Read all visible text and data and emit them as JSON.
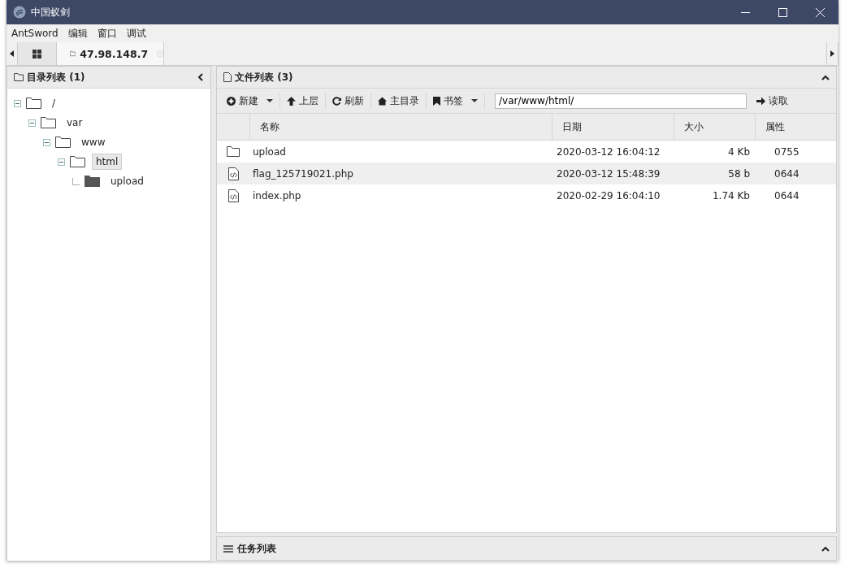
{
  "window": {
    "title": "中国蚁剑"
  },
  "menu": [
    "AntSword",
    "编辑",
    "窗口",
    "调试"
  ],
  "tabs": [
    {
      "label": "47.98.148.7",
      "selected": true
    }
  ],
  "dir_panel": {
    "title": "目录列表 (1)",
    "tree": [
      {
        "label": "/",
        "expanded": true,
        "selected": false,
        "children": [
          {
            "label": "var",
            "expanded": true,
            "selected": false,
            "children": [
              {
                "label": "www",
                "expanded": true,
                "selected": false,
                "children": [
                  {
                    "label": "html",
                    "expanded": true,
                    "selected": true,
                    "children": [
                      {
                        "label": "upload",
                        "expanded": false,
                        "selected": false
                      }
                    ]
                  }
                ]
              }
            ]
          }
        ]
      }
    ]
  },
  "file_panel": {
    "title": "文件列表 (3)",
    "toolbar": [
      {
        "kind": "new",
        "label": "新建",
        "dropdown": true
      },
      {
        "kind": "up",
        "label": "上层",
        "dropdown": false
      },
      {
        "kind": "refresh",
        "label": "刷新",
        "dropdown": false
      },
      {
        "kind": "home",
        "label": "主目录",
        "dropdown": false
      },
      {
        "kind": "bookmark",
        "label": "书签",
        "dropdown": true
      }
    ],
    "path": "/var/www/html/",
    "read_button": "读取",
    "columns": [
      "名称",
      "日期",
      "大小",
      "属性"
    ],
    "rows": [
      {
        "kind": "folder",
        "name": "upload",
        "date": "2020-03-12 16:04:12",
        "size": "4 Kb",
        "perm": "0755",
        "selected": false
      },
      {
        "kind": "file",
        "name": "flag_125719021.php",
        "date": "2020-03-12 15:48:39",
        "size": "58 b",
        "perm": "0644",
        "selected": true
      },
      {
        "kind": "file",
        "name": "index.php",
        "date": "2020-02-29 16:04:10",
        "size": "1.74 Kb",
        "perm": "0644",
        "selected": false
      }
    ]
  },
  "task_panel": {
    "title": "任务列表"
  }
}
